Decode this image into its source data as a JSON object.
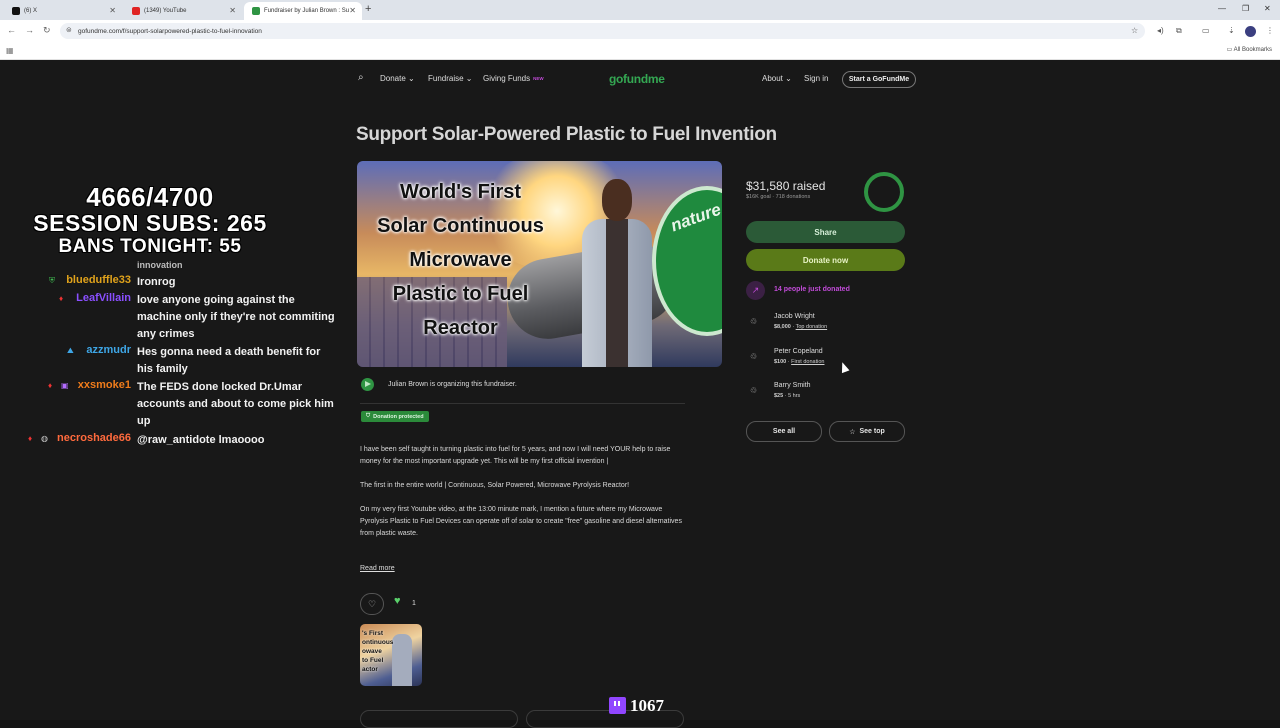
{
  "browser": {
    "tabs": [
      {
        "label": "(6) X"
      },
      {
        "label": "(1349) YouTube"
      },
      {
        "label": "Fundraiser by Julian Brown : Su"
      }
    ],
    "url": "gofundme.com/f/support-solarpowered-plastic-to-fuel-innovation",
    "all_bookmarks": "All Bookmarks"
  },
  "nav": {
    "donate": "Donate",
    "fundraise": "Fundraise",
    "giving_funds": "Giving Funds",
    "new_badge": "NEW",
    "logo": "gofundme",
    "about": "About",
    "sign_in": "Sign in",
    "start": "Start a GoFundMe"
  },
  "campaign": {
    "title": "Support Solar-Powered Plastic to Fuel Invention",
    "hero_text": [
      "World's First",
      "Solar Continuous",
      "Microwave",
      "Plastic to Fuel",
      "Reactor"
    ],
    "hero_seal": "nature",
    "organizer": "Julian Brown is organizing this fundraiser.",
    "protected": "Donation protected",
    "desc1": "I have been self taught in turning plastic into fuel for 5 years, and now I will need YOUR help to raise money for the most important upgrade yet. This will be my first official invention |",
    "desc2": "The first in the entire world | Continuous, Solar Powered, Microwave Pyrolysis Reactor!",
    "desc3": "On my very first Youtube video, at the 13:00 minute mark, I mention a future where my Microwave Pyrolysis Plastic to Fuel Devices can operate off of solar to create \"free\" gasoline and diesel alternatives from plastic waste.",
    "read_more": "Read more",
    "heart_count": "1",
    "thumb_text": [
      "'s First",
      "ontinuous",
      "owave",
      "to Fuel",
      "actor"
    ]
  },
  "card": {
    "raised": "$31,580 raised",
    "goal": "$16K goal  ·  718 donations",
    "share": "Share",
    "donate": "Donate now",
    "trend": "14 people just donated",
    "donors": [
      {
        "name": "Jacob Wright",
        "amount": "$8,000",
        "sep": " · ",
        "tag": "Top donation"
      },
      {
        "name": "Peter Copeland",
        "amount": "$100",
        "sep": " · ",
        "tag": "First donation"
      },
      {
        "name": "Barry Smith",
        "amount": "$25",
        "sep": " · ",
        "tag": "5 hrs"
      }
    ],
    "see_all": "See all",
    "see_top": "See top"
  },
  "overlay": {
    "counter": "4666/4700",
    "session_subs": "SESSION SUBS: 265",
    "bans": "BANS TONIGHT: 55",
    "cut_text": "innovation",
    "chat": [
      {
        "user": "blueduffle33",
        "color": "#e0a21b",
        "msg": "Ironrog"
      },
      {
        "user": "LeafVillain",
        "color": "#8a4fff",
        "msg": "love anyone going against the machine only if they're not commiting any crimes"
      },
      {
        "user": "azzmudr",
        "color": "#3ea6e6",
        "msg": "Hes gonna need a death benefit for his family"
      },
      {
        "user": "xxsmoke1",
        "color": "#f07c1b",
        "msg": "The FEDS done locked Dr.Umar accounts and about to come pick him up"
      },
      {
        "user": "necroshade66",
        "color": "#ff6a3d",
        "msg": "@raw_antidote lmaoooo"
      }
    ],
    "viewers": "1067"
  }
}
